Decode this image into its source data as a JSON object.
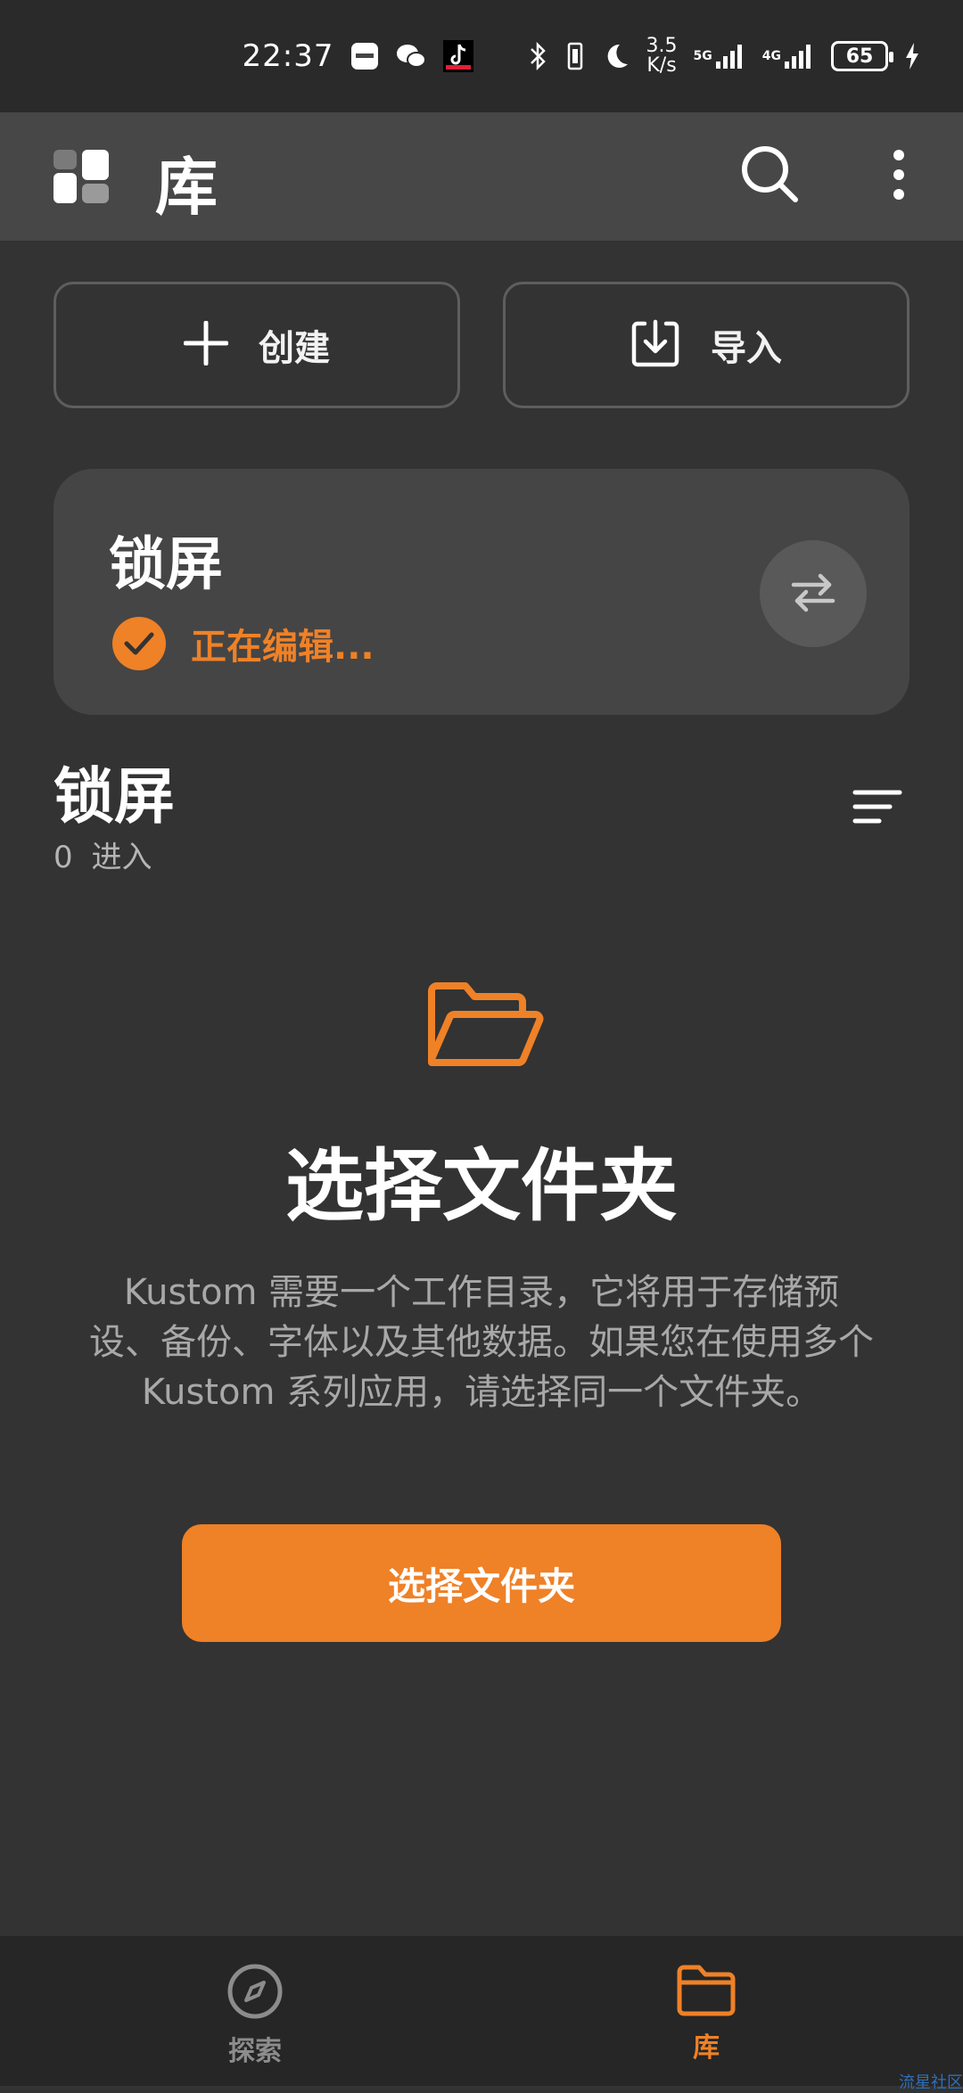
{
  "status_bar": {
    "time": "22:37",
    "net_speed_top": "3.5",
    "net_speed_bottom": "K/s",
    "signal_1": "5G",
    "signal_2": "4G",
    "battery": "65"
  },
  "app_bar": {
    "title": "库",
    "icons": [
      "kustom-logo-icon",
      "search-icon",
      "more-vert-icon"
    ]
  },
  "actions": {
    "create_label": "创建",
    "import_label": "导入"
  },
  "current": {
    "title": "锁屏",
    "status": "正在编辑..."
  },
  "section": {
    "title": "锁屏",
    "count": "0",
    "count_label": "进入"
  },
  "empty_state": {
    "title": "选择文件夹",
    "description": "Kustom 需要一个工作目录，它将用于存储预设、备份、字体以及其他数据。如果您在使用多个 Kustom 系列应用，请选择同一个文件夹。",
    "button_label": "选择文件夹"
  },
  "bottom_nav": {
    "items": [
      {
        "label": "探索",
        "icon": "compass-icon",
        "active": false
      },
      {
        "label": "库",
        "icon": "folder-icon",
        "active": true
      }
    ]
  },
  "watermark": "流星社区",
  "colors": {
    "accent": "#ef8127",
    "background": "#333333",
    "app_bar": "#474747",
    "card": "#454545",
    "nav": "#262626"
  }
}
